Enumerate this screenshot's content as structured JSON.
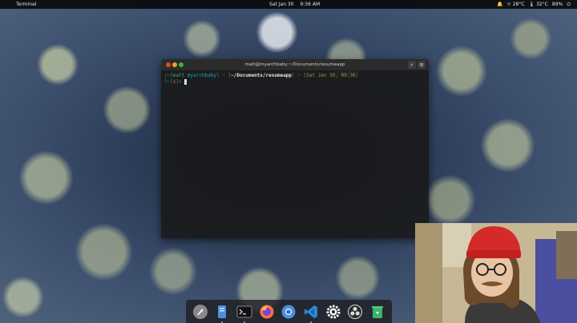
{
  "topbar": {
    "app_name": "Terminal",
    "date": "Sat Jan 30",
    "time": "9:36 AM",
    "tray": {
      "weather": "28°C",
      "temp": "32°C",
      "percent": "89%"
    }
  },
  "terminal": {
    "title": "matt@myarchbaby:~/Documents/resumeapp",
    "prompt": {
      "user": "matt",
      "host": "myarchbaby",
      "path": "~/Documents/resumeapp",
      "datetime": "Sat Jan 30, 09:36",
      "symbol": "$"
    }
  },
  "dock": {
    "items": [
      {
        "icon": "rocket-launcher-icon",
        "label": "Launcher"
      },
      {
        "icon": "files-icon",
        "label": "Files"
      },
      {
        "icon": "terminal-icon",
        "label": "Terminal"
      },
      {
        "icon": "firefox-icon",
        "label": "Firefox"
      },
      {
        "icon": "chromium-icon",
        "label": "Chromium"
      },
      {
        "icon": "vscode-icon",
        "label": "Visual Studio Code"
      },
      {
        "icon": "settings-gear-icon",
        "label": "Settings"
      },
      {
        "icon": "obs-icon",
        "label": "OBS"
      },
      {
        "icon": "trash-icon",
        "label": "Trash"
      }
    ]
  },
  "colors": {
    "topbar_bg": "#0a0a0c",
    "terminal_bg": "#181818",
    "prompt_user": "#48a860",
    "prompt_host": "#2aa0b8",
    "prompt_date": "#b89234"
  }
}
